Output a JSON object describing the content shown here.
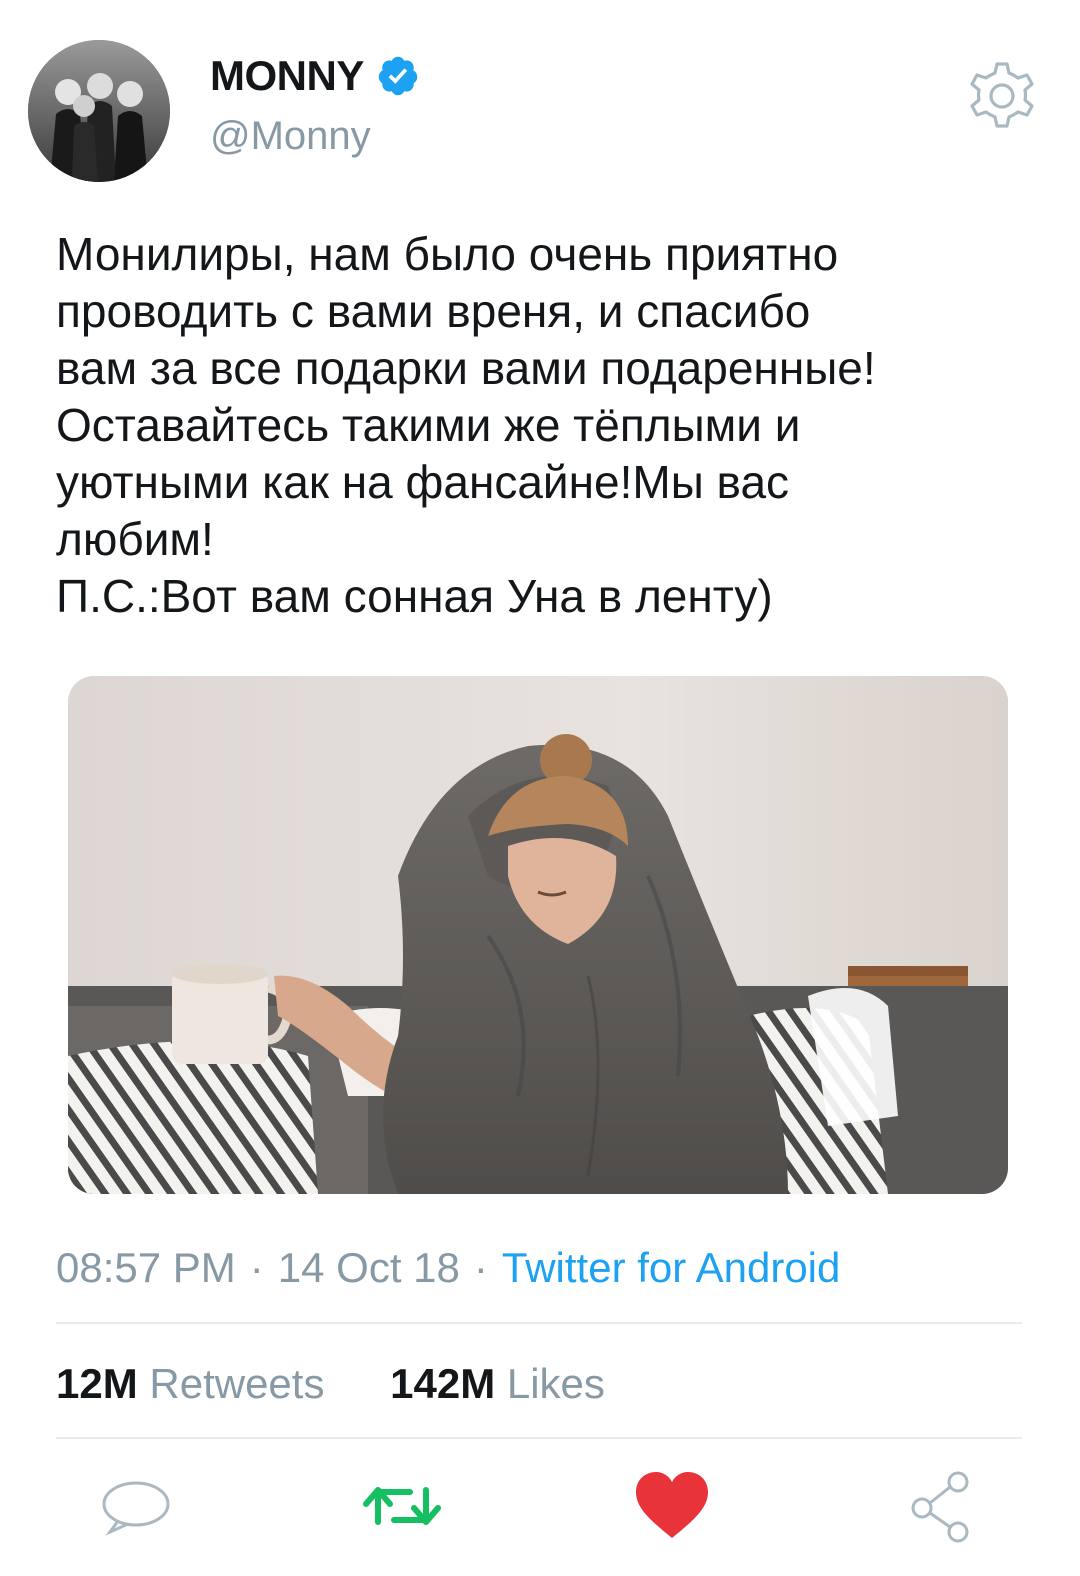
{
  "header": {
    "display_name": "MONNY",
    "handle": "@Monny",
    "avatar_icon": "group-photo-avatar",
    "verified_icon": "verified-badge-icon",
    "settings_icon": "gear-icon"
  },
  "tweet": {
    "text": "Монилиры, нам было очень приятно\nпроводить с вами вреня, и спасибо\nвам за все подарки вами подаренные!\nОставайтесь такими же тёплыми и\nуютными как на фансайне!Мы вас\nлюбим!\nП.С.:Вот вам сонная Уна в ленту)",
    "media_icon": "photo-woman-wrapped-in-blanket-with-mug"
  },
  "meta": {
    "time": "08:57 PM",
    "separator": "·",
    "date": "14 Oct 18",
    "source": "Twitter for Android"
  },
  "stats": {
    "retweets_count": "12M",
    "retweets_label": "Retweets",
    "likes_count": "142M",
    "likes_label": "Likes"
  },
  "actions": [
    {
      "name": "reply",
      "icon": "reply-bubble-icon"
    },
    {
      "name": "retweet",
      "icon": "retweet-icon"
    },
    {
      "name": "like",
      "icon": "heart-icon"
    },
    {
      "name": "share",
      "icon": "share-icon"
    }
  ],
  "colors": {
    "accent": "#1da1f2",
    "retweet_green": "#17bf63",
    "like_red": "#e0245e",
    "muted": "#8899a6"
  }
}
